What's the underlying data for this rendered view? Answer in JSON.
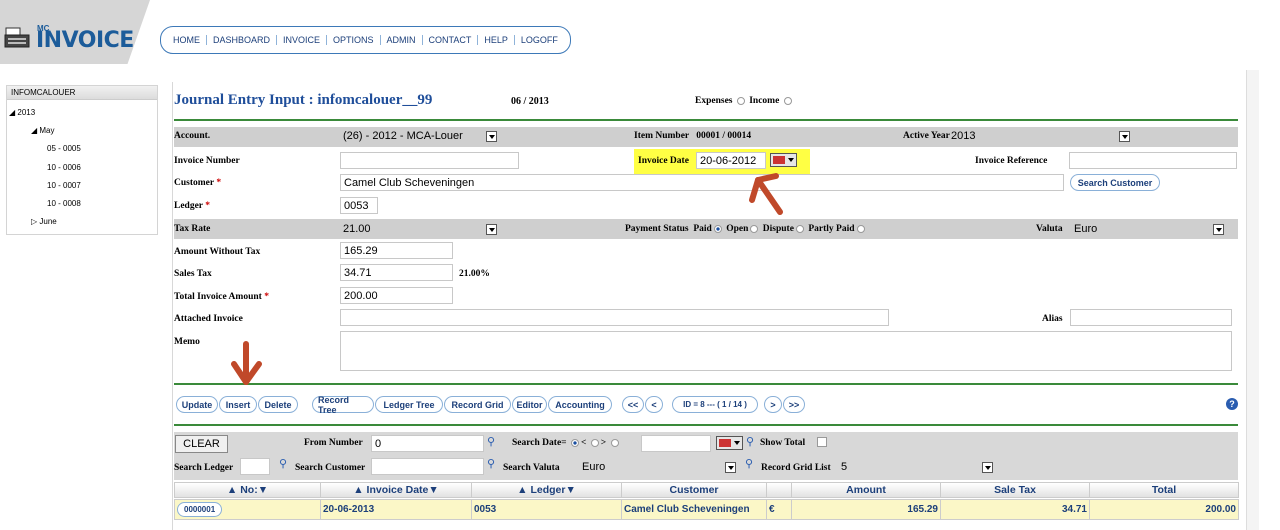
{
  "logo": {
    "mc": "MC",
    "name": "INVOICE"
  },
  "nav": [
    "HOME",
    "DASHBOARD",
    "INVOICE",
    "OPTIONS",
    "ADMIN",
    "CONTACT",
    "HELP",
    "LOGOFF"
  ],
  "tree": {
    "header": "INFOMCALOUER",
    "year": "2013",
    "month1": "May",
    "entries": [
      "05 - 0005",
      "10 - 0006",
      "10 - 0007",
      "10 - 0008"
    ],
    "month2": "June"
  },
  "form": {
    "title": "Journal Entry Input : infomcalouer__99",
    "period": "06 / 2013",
    "expenses_label": "Expenses",
    "income_label": "Income",
    "account_label": "Account.",
    "account_value": "(26) - 2012 - MCA-Louer",
    "item_number_label": "Item Number",
    "item_number_value": "00001  /  00014",
    "active_year_label": "Active Year",
    "active_year_value": "2013",
    "invoice_number_label": "Invoice Number",
    "invoice_number_value": "",
    "invoice_date_label": "Invoice Date",
    "invoice_date_value": "20-06-2012",
    "invoice_reference_label": "Invoice Reference",
    "invoice_reference_value": "",
    "customer_label": "Customer",
    "customer_value": "Camel Club Scheveningen",
    "search_customer_button": "Search Customer",
    "ledger_label": "Ledger",
    "ledger_value": "0053",
    "required_mark": "*",
    "tax_rate_label": "Tax Rate",
    "tax_rate_value": "21.00",
    "payment_status_label": "Payment Status",
    "paid_label": "Paid",
    "open_label": "Open",
    "dispute_label": "Dispute",
    "partly_paid_label": "Partly Paid",
    "valuta_label": "Valuta",
    "valuta_value": "Euro",
    "amount_without_tax_label": "Amount Without Tax",
    "amount_without_tax_value": "165.29",
    "sales_tax_label": "Sales Tax",
    "sales_tax_value": "34.71",
    "sales_tax_percent": "21.00%",
    "total_invoice_amount_label": "Total Invoice Amount",
    "total_invoice_amount_value": "200.00",
    "attached_invoice_label": "Attached Invoice",
    "attached_invoice_value": "",
    "alias_label": "Alias",
    "alias_value": "",
    "memo_label": "Memo",
    "memo_value": ""
  },
  "actions": {
    "update": "Update",
    "insert": "Insert",
    "delete": "Delete",
    "record_tree": "Record Tree",
    "ledger_tree": "Ledger Tree",
    "record_grid": "Record Grid",
    "editor": "Editor",
    "accounting": "Accounting",
    "first": "<<",
    "prev": "<",
    "record_id": "ID = 8 --- ( 1 / 14 )",
    "next": ">",
    "last": ">>"
  },
  "search": {
    "clear": "CLEAR",
    "from_number_label": "From Number",
    "from_number_value": "0",
    "search_date_label": "Search Date",
    "eq": "=",
    "lt": "<",
    "gt": ">",
    "search_date_value": "",
    "show_total_label": "Show Total",
    "search_ledger_label": "Search Ledger",
    "search_ledger_value": "",
    "search_customer_label": "Search Customer",
    "search_customer_value": "",
    "search_valuta_label": "Search Valuta",
    "search_valuta_value": "Euro",
    "record_grid_list_label": "Record Grid List",
    "record_grid_list_value": "5"
  },
  "grid": {
    "headers": [
      "▲ No:▼",
      "▲ Invoice Date▼",
      "▲ Ledger▼",
      "Customer",
      "",
      "Amount",
      "Sale Tax",
      "Total"
    ],
    "row": {
      "no": "0000001",
      "date": "20-06-2013",
      "ledger": "0053",
      "customer": "Camel Club Scheveningen",
      "currency": "€",
      "amount": "165.29",
      "tax": "34.71",
      "total": "200.00"
    }
  },
  "colors": {
    "accent": "#1f4e9a",
    "highlight": "#ffff44",
    "arrow": "#c0492a",
    "rule": "#3a8a3a"
  }
}
